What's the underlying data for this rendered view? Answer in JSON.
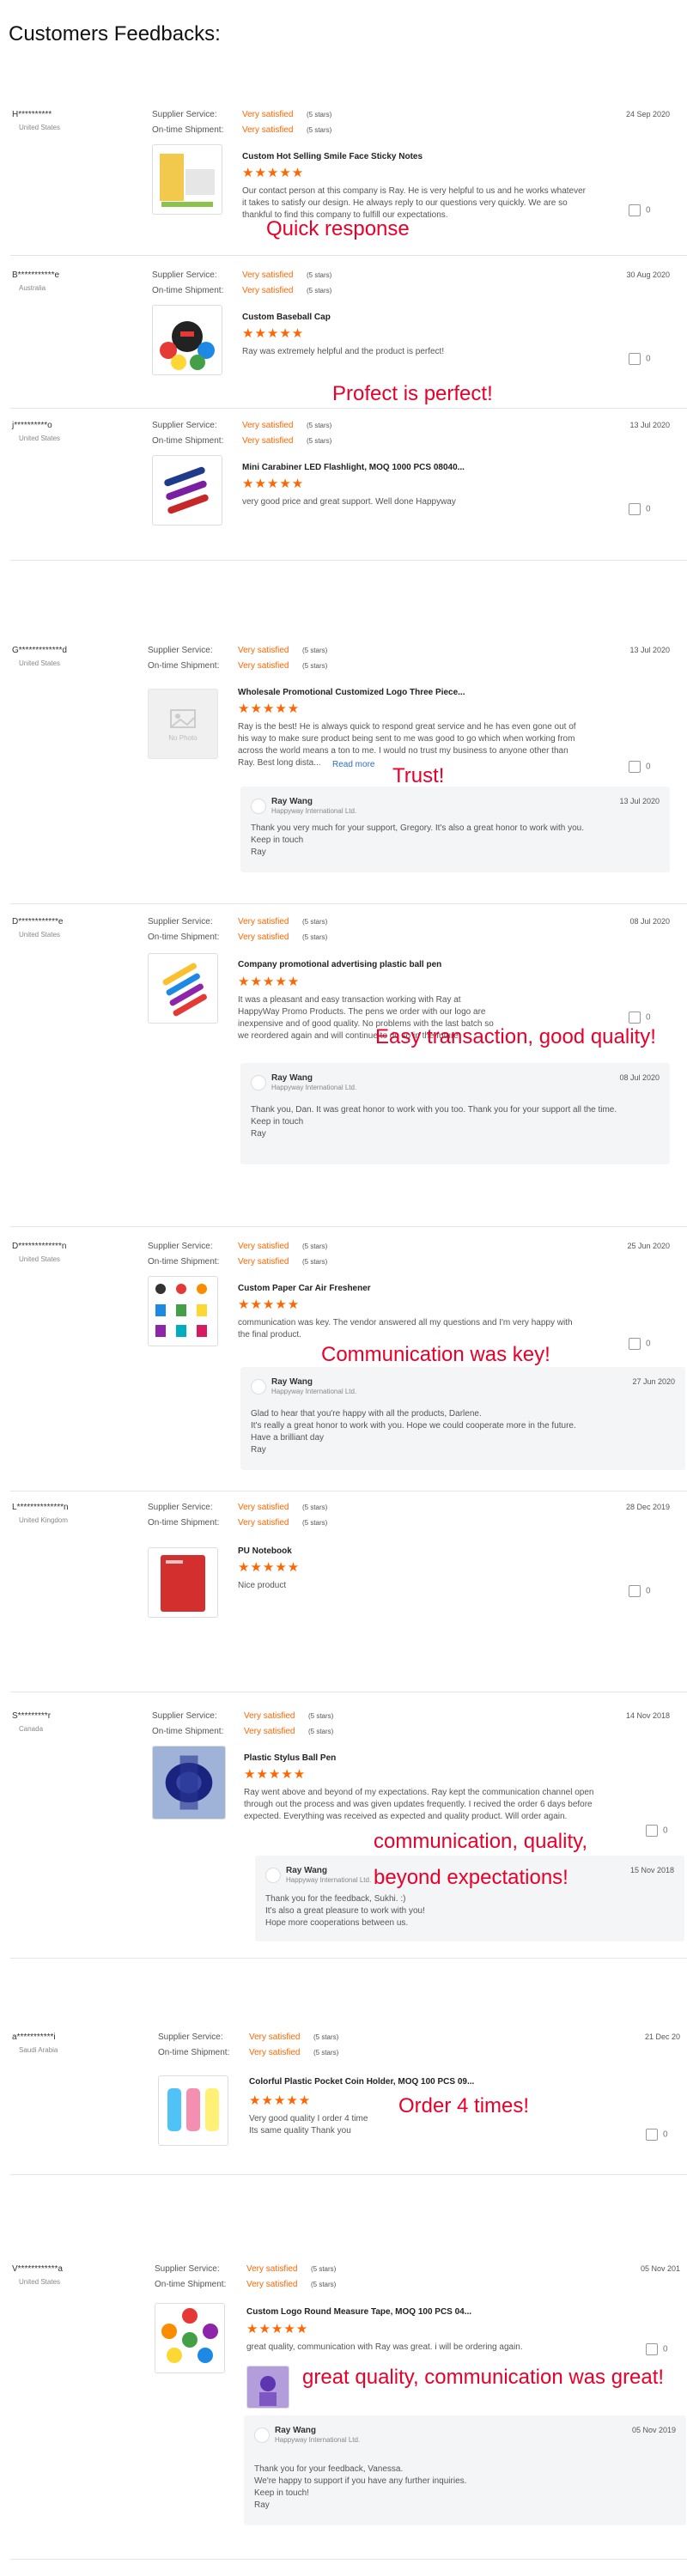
{
  "page_title": "Customers Feedbacks:",
  "labels": {
    "supplier_service": "Supplier Service:",
    "on_time_shipment": "On-time Shipment:",
    "rating_value": "Very satisfied",
    "rating_stars_text": "(5 stars)",
    "stars": "★★★★★",
    "like_count": "0",
    "read_more": "Read more"
  },
  "colors": {
    "accent": "#ff6600",
    "note": "#e8002a",
    "link": "#2b6cd1"
  },
  "reviews": [
    {
      "name": "H**********",
      "country": "United States",
      "date": "24 Sep 2020",
      "product": "Custom Hot Selling Smile Face Sticky Notes",
      "comment": "Our contact person at this company is Ray.  He is very helpful to us and he works whatever it takes to satisfy our design.  He always reply to our questions very quickly.  We are so thankful to find this company to fulfill our expectations.",
      "note": "Quick response"
    },
    {
      "name": "B***********e",
      "country": "Australia",
      "date": "30 Aug 2020",
      "product": "Custom Baseball Cap",
      "comment": "Ray was extremely helpful and the product is perfect!",
      "note": "Profect is perfect!"
    },
    {
      "name": "j**********o",
      "country": "United States",
      "date": "13 Jul 2020",
      "product": "Mini Carabiner LED Flashlight, MOQ 1000 PCS 08040...",
      "comment": "very good price and great support. Well done Happyway"
    },
    {
      "name": "G*************d",
      "country": "United States",
      "date": "13 Jul 2020",
      "product": "Wholesale Promotional Customized Logo Three Piece...",
      "thumb_text": "No Photo",
      "comment": "Ray is the best! He is always quick to respond great service and he has even gone out of his way to make sure product being sent to me was good to go which when working from across the world means a ton to me. I would no trust my business to anyone other than Ray. Best long dista...",
      "note": "Trust!",
      "reply": {
        "name": "Ray Wang",
        "company": "Happyway International Ltd.",
        "date": "13 Jul 2020",
        "text": "Thank you very much for your support, Gregory. It's also a great honor to work with you.\nKeep in touch\nRay"
      }
    },
    {
      "name": "D************e",
      "country": "United States",
      "date": "08 Jul 2020",
      "product": "Company promotional advertising plastic ball pen",
      "comment": "It was a pleasant and easy transaction working with Ray at HappyWay Promo Products. The pens we order with our logo are inexpensive and of good quality. No problems with the last batch so we reordered again and will continue to do so in the future.",
      "note": "Easy transaction, good quality!",
      "reply": {
        "name": "Ray Wang",
        "company": "Happyway International Ltd.",
        "date": "08 Jul 2020",
        "text": "Thank you, Dan. It was great honor to work with you too. Thank you for your support all the time.\nKeep in touch\nRay"
      }
    },
    {
      "name": "D*************n",
      "country": "United States",
      "date": "25 Jun 2020",
      "product": "Custom Paper Car Air Freshener",
      "comment": "communication was key. The vendor answered all my questions and I'm very happy with the final product.",
      "note": "Communication was key!",
      "reply": {
        "name": "Ray Wang",
        "company": "Happyway International Ltd.",
        "date": "27 Jun 2020",
        "text": "Glad to hear that you're happy with all the products, Darlene.\nIt's really a great honor to work with you. Hope we could cooperate more in the future.\nHave a brilliant day\nRay"
      }
    },
    {
      "name": "L**************n",
      "country": "United Kingdom",
      "date": "28 Dec 2019",
      "product": "PU Notebook",
      "comment": "Nice product"
    },
    {
      "name": "S*********r",
      "country": "Canada",
      "date": "14 Nov 2018",
      "product": "Plastic Stylus Ball Pen",
      "comment": "Ray went above and beyond of my expectations.  Ray kept the communication channel open through out the process and was given updates frequently.  I recived the order 6 days before expected.  Everything was received as expected and quality product.  Will order again.",
      "note_lines": [
        "communication, quality,",
        "beyond expectations!"
      ],
      "reply": {
        "name": "Ray Wang",
        "company": "Happyway International Ltd.",
        "date": "15 Nov 2018",
        "text": "Thank you for the feedback, Sukhi. :)\nIt's also a great pleasure to work with you!\nHope more cooperations between us."
      }
    },
    {
      "name": "a***********i",
      "country": "Saudi Arabia",
      "date": "21 Dec 20",
      "product": "Colorful Plastic Pocket Coin Holder, MOQ 100 PCS 09...",
      "comment": "Very good quality I order 4 time\nIts same quality Thank you",
      "note": "Order 4 times!"
    },
    {
      "name": "V************a",
      "country": "United States",
      "date": "05 Nov 201",
      "product": "Custom Logo Round Measure Tape, MOQ 100 PCS 04...",
      "comment": "great quality, communication with Ray was great. i will be ordering again.",
      "note": "great quality, communication was great!",
      "reply": {
        "name": "Ray Wang",
        "company": "Happyway International Ltd.",
        "date": "05 Nov 2019",
        "text": "Thank you for your feedback, Vanessa.\nWe're happy to support if you have any further inquiries.\nKeep in touch!\nRay"
      }
    }
  ]
}
